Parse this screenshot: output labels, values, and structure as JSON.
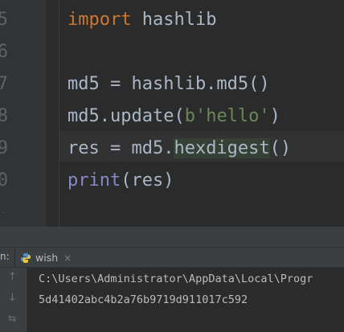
{
  "editor": {
    "line_numbers": [
      "5",
      "6",
      "7",
      "8",
      "9",
      "0",
      "1"
    ],
    "lines": [
      {
        "kw": "import",
        "rest": " hashlib"
      },
      {
        "text": ""
      },
      {
        "text": "md5 = hashlib.md5()"
      },
      {
        "pre": "md5.update(",
        "str": "b'hello'",
        "post": ")"
      },
      {
        "pre": "res = md5.",
        "highlight": "hexdigest",
        "post": "()"
      },
      {
        "builtin": "print",
        "post": "(res)"
      }
    ]
  },
  "tool_window": {
    "prefix": "n:",
    "tab_label": "wish",
    "tab_close": "×",
    "up_icon": "arrow-up-icon",
    "down_icon": "arrow-down-icon"
  },
  "console": {
    "lines": [
      "C:\\Users\\Administrator\\AppData\\Local\\Progr",
      "5d41402abc4b2a76b9719d911017c592"
    ]
  },
  "colors": {
    "keyword": "#cc7832",
    "string": "#6a8759",
    "builtin": "#8888c6",
    "text": "#a9b7c6",
    "background": "#2b2b2b"
  }
}
